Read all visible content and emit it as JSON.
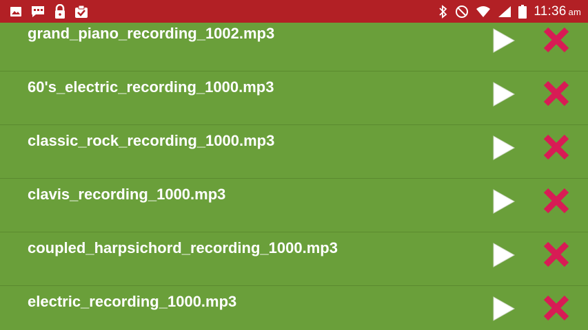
{
  "status_bar": {
    "time": "11:36",
    "ampm": "am",
    "left_icons": [
      "image-icon",
      "message-icon",
      "lock-icon",
      "clipboard-check-icon"
    ],
    "right_icons": [
      "bluetooth-icon",
      "do-not-disturb-icon",
      "wifi-icon",
      "signal-icon",
      "battery-icon"
    ]
  },
  "recordings": [
    {
      "name": "grand_piano_recording_1002.mp3"
    },
    {
      "name": "60's_electric_recording_1000.mp3"
    },
    {
      "name": "classic_rock_recording_1000.mp3"
    },
    {
      "name": "clavis_recording_1000.mp3"
    },
    {
      "name": "coupled_harpsichord_recording_1000.mp3"
    },
    {
      "name": "electric_recording_1000.mp3"
    }
  ],
  "colors": {
    "status_bar": "#b22025",
    "list_background": "#6a9f3a",
    "delete_icon": "#d81b55",
    "play_icon": "#ffffff"
  }
}
